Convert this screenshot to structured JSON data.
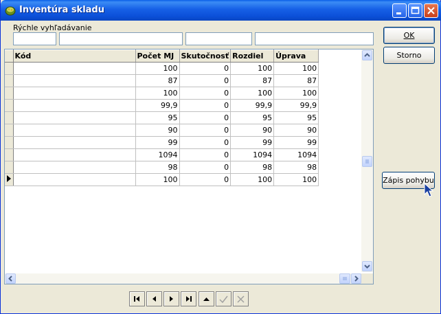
{
  "window": {
    "title": "Inventúra skladu"
  },
  "search": {
    "label": "Rýchle vyhľadávanie",
    "fields": [
      "",
      "",
      "",
      ""
    ]
  },
  "buttons": {
    "ok": "OK",
    "cancel": "Storno",
    "record_movement": "Zápis pohybu"
  },
  "table": {
    "columns": [
      "Kód",
      "Počet MJ",
      "Skutočnosť",
      "Rozdiel",
      "Úprava"
    ],
    "rows": [
      [
        "",
        "100",
        "0",
        "100",
        "100"
      ],
      [
        "",
        "87",
        "0",
        "87",
        "87"
      ],
      [
        "",
        "100",
        "0",
        "100",
        "100"
      ],
      [
        "",
        "99,9",
        "0",
        "99,9",
        "99,9"
      ],
      [
        "",
        "95",
        "0",
        "95",
        "95"
      ],
      [
        "",
        "90",
        "0",
        "90",
        "90"
      ],
      [
        "",
        "99",
        "0",
        "99",
        "99"
      ],
      [
        "",
        "1094",
        "0",
        "1094",
        "1094"
      ],
      [
        "",
        "98",
        "0",
        "98",
        "98"
      ],
      [
        "",
        "100",
        "0",
        "100",
        "100"
      ]
    ],
    "current_row": 9
  },
  "navigator": [
    "first-icon",
    "prior-icon",
    "next-icon",
    "last-icon",
    "insert-icon",
    "post-icon",
    "cancel-icon"
  ]
}
